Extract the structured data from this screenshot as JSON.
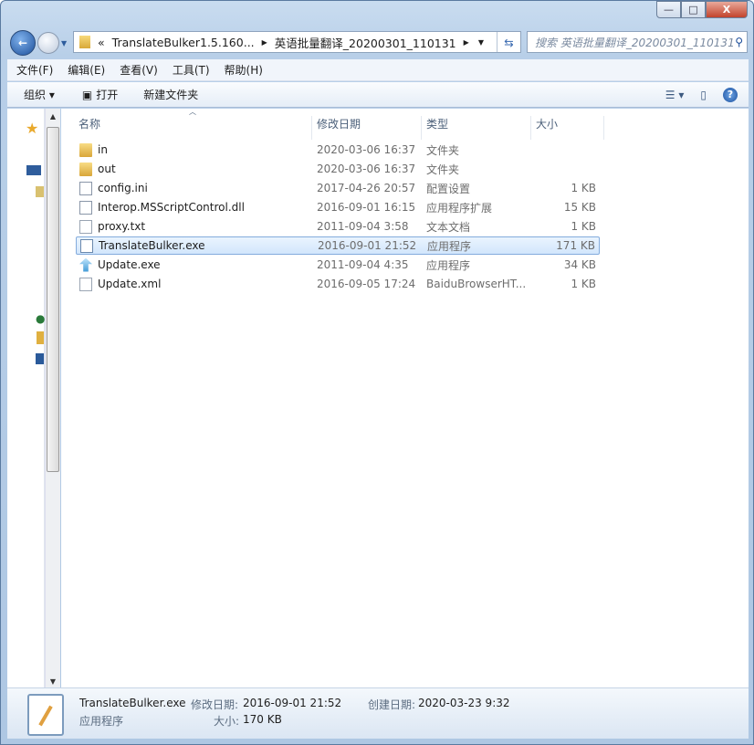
{
  "window_controls": {
    "minimize": "—",
    "maximize": "□",
    "close": "X"
  },
  "address": {
    "overflow": "«",
    "segments": [
      "TranslateBulker1.5.160...",
      "英语批量翻译_20200301_110131"
    ]
  },
  "search": {
    "placeholder": "搜索 英语批量翻译_20200301_110131"
  },
  "menu": [
    "文件(F)",
    "编辑(E)",
    "查看(V)",
    "工具(T)",
    "帮助(H)"
  ],
  "toolbar": {
    "organize": "组织 ▾",
    "open": "打开",
    "new_folder": "新建文件夹",
    "help": "?"
  },
  "columns": {
    "name": "名称",
    "date": "修改日期",
    "type": "类型",
    "size": "大小"
  },
  "files": [
    {
      "name": "in",
      "date": "2020-03-06 16:37",
      "type": "文件夹",
      "size": "",
      "icon": "folder"
    },
    {
      "name": "out",
      "date": "2020-03-06 16:37",
      "type": "文件夹",
      "size": "",
      "icon": "folder"
    },
    {
      "name": "config.ini",
      "date": "2017-04-26 20:57",
      "type": "配置设置",
      "size": "1 KB",
      "icon": "ini"
    },
    {
      "name": "Interop.MSScriptControl.dll",
      "date": "2016-09-01 16:15",
      "type": "应用程序扩展",
      "size": "15 KB",
      "icon": "dll"
    },
    {
      "name": "proxy.txt",
      "date": "2011-09-04 3:58",
      "type": "文本文档",
      "size": "1 KB",
      "icon": "txt"
    },
    {
      "name": "TranslateBulker.exe",
      "date": "2016-09-01 21:52",
      "type": "应用程序",
      "size": "171 KB",
      "icon": "exe",
      "selected": true
    },
    {
      "name": "Update.exe",
      "date": "2011-09-04 4:35",
      "type": "应用程序",
      "size": "34 KB",
      "icon": "update"
    },
    {
      "name": "Update.xml",
      "date": "2016-09-05 17:24",
      "type": "BaiduBrowserHT...",
      "size": "1 KB",
      "icon": "xml"
    }
  ],
  "details": {
    "name": "TranslateBulker.exe",
    "type": "应用程序",
    "modified_label": "修改日期:",
    "modified": "2016-09-01 21:52",
    "created_label": "创建日期:",
    "created": "2020-03-23 9:32",
    "size_label": "大小:",
    "size": "170 KB"
  }
}
